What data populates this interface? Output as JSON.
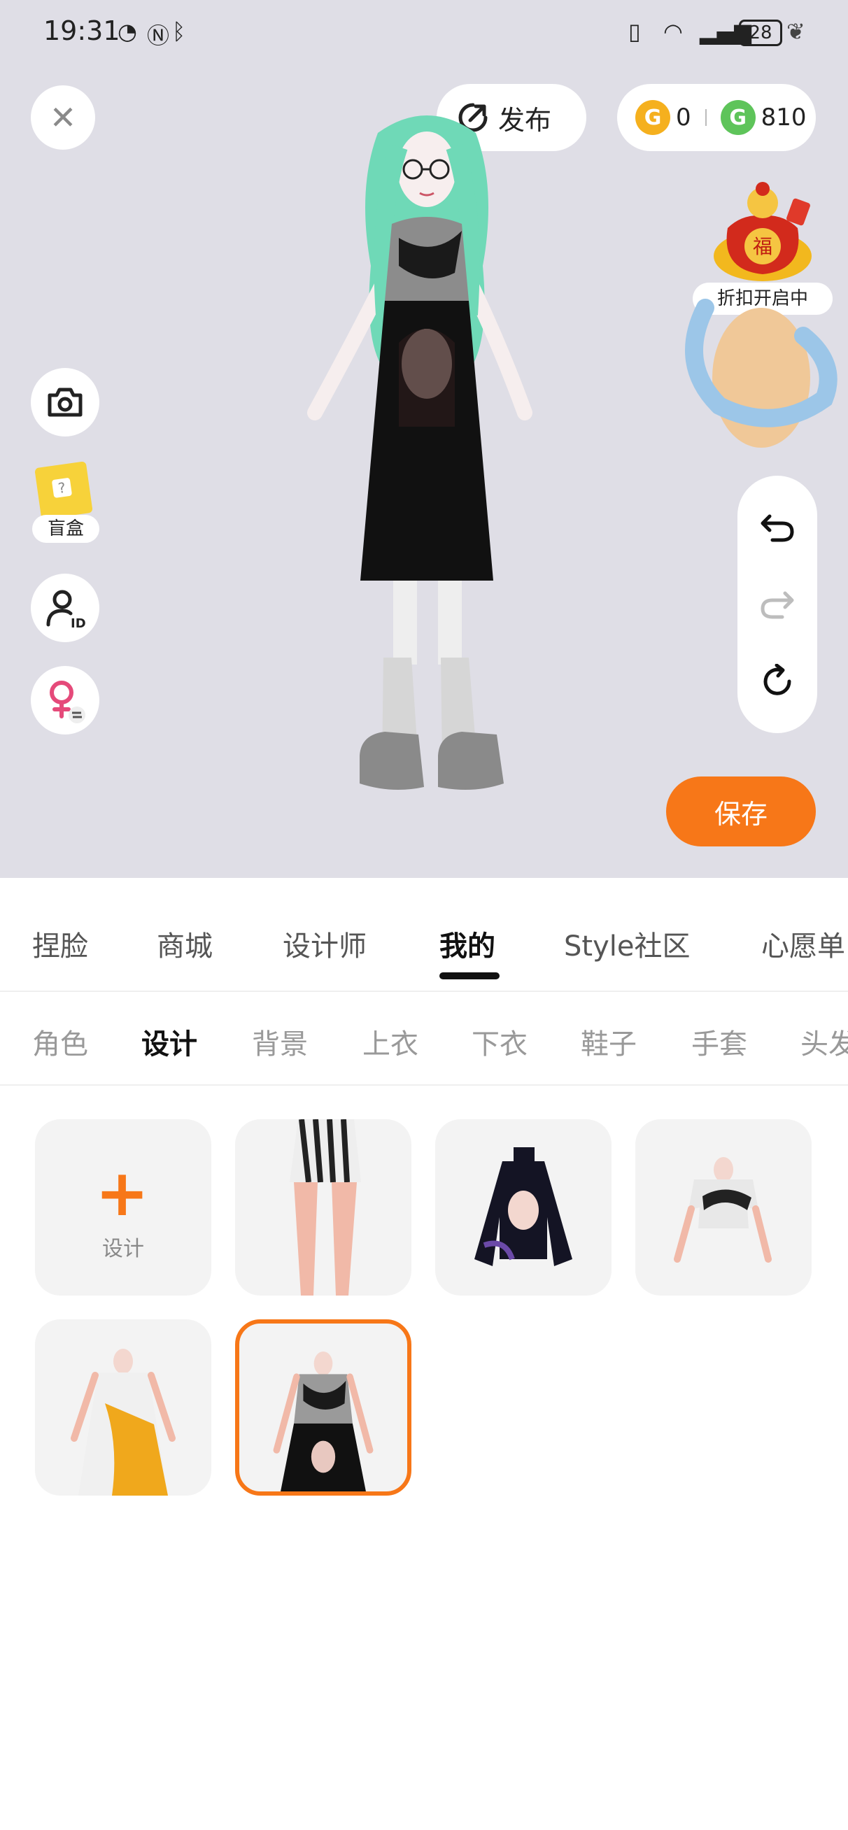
{
  "status_bar": {
    "time": "19:31",
    "battery": "28"
  },
  "top": {
    "publish_label": "发布",
    "coins": {
      "gold": "0",
      "green": "810"
    },
    "promo_label": "折扣开启中"
  },
  "left_tools": {
    "blind_box_label": "盲盒"
  },
  "save_label": "保存",
  "main_tabs": [
    {
      "label": "捏脸"
    },
    {
      "label": "商城"
    },
    {
      "label": "设计师"
    },
    {
      "label": "我的"
    },
    {
      "label": "Style社区"
    },
    {
      "label": "心愿单"
    }
  ],
  "main_tabs_active": "我的",
  "sub_tabs": [
    {
      "label": "角色"
    },
    {
      "label": "设计"
    },
    {
      "label": "背景"
    },
    {
      "label": "上衣"
    },
    {
      "label": "下衣"
    },
    {
      "label": "鞋子"
    },
    {
      "label": "手套"
    },
    {
      "label": "头发"
    }
  ],
  "sub_tabs_active": "设计",
  "design_grid": {
    "add_label": "设计",
    "items": [
      {
        "name": "striped-skirt"
      },
      {
        "name": "black-printed-jacket"
      },
      {
        "name": "black-white-crop-top"
      },
      {
        "name": "orange-white-dress"
      },
      {
        "name": "black-grey-dress",
        "selected": true
      }
    ]
  },
  "colors": {
    "accent": "#f77718",
    "stage_bg": "#dfdee6"
  }
}
